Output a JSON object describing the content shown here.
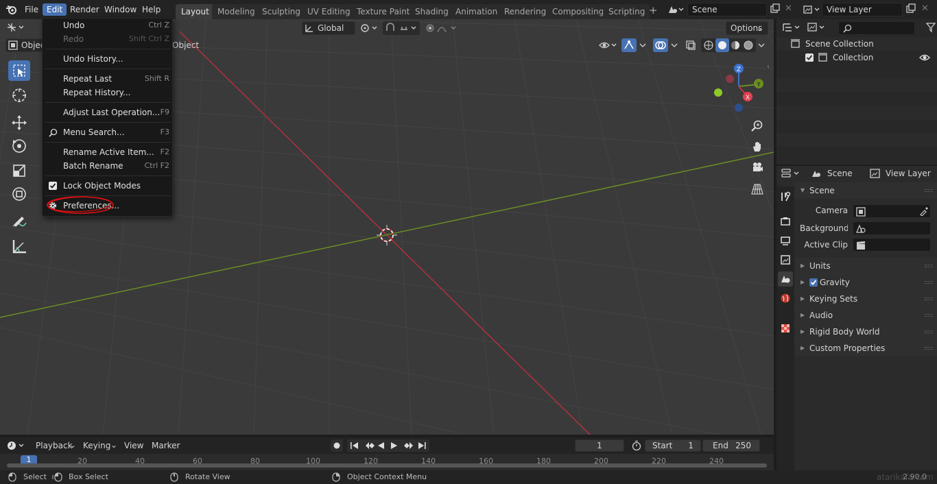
{
  "topbar": {
    "menus": [
      "File",
      "Edit",
      "Render",
      "Window",
      "Help"
    ],
    "active_menu": "Edit",
    "workspaces": [
      "Layout",
      "Modeling",
      "Sculpting",
      "UV Editing",
      "Texture Paint",
      "Shading",
      "Animation",
      "Rendering",
      "Compositing",
      "Scripting"
    ],
    "active_workspace": "Layout",
    "scene_name": "Scene",
    "view_layer_name": "View Layer"
  },
  "viewport_header": {
    "transform_orientation": "Global",
    "options_label": "Options",
    "mode_label": "Object",
    "object_menu": "Object"
  },
  "edit_menu": {
    "items": [
      {
        "label": "Undo",
        "shortcut": "Ctrl Z",
        "enabled": true
      },
      {
        "label": "Redo",
        "shortcut": "Shift Ctrl Z",
        "enabled": false
      },
      {
        "label": "Undo History...",
        "shortcut": "",
        "enabled": true
      },
      {
        "label": "Repeat Last",
        "shortcut": "Shift R",
        "enabled": true
      },
      {
        "label": "Repeat History...",
        "shortcut": "",
        "enabled": true
      },
      {
        "label": "Adjust Last Operation...",
        "shortcut": "F9",
        "enabled": true
      },
      {
        "label": "Menu Search...",
        "shortcut": "F3",
        "enabled": true
      },
      {
        "label": "Rename Active Item...",
        "shortcut": "F2",
        "enabled": true
      },
      {
        "label": "Batch Rename",
        "shortcut": "Ctrl F2",
        "enabled": true
      },
      {
        "label": "Lock Object Modes",
        "shortcut": "",
        "enabled": true,
        "checked": true
      },
      {
        "label": "Preferences...",
        "shortcut": "",
        "enabled": true,
        "highlighted": true
      }
    ]
  },
  "outliner": {
    "root": "Scene Collection",
    "children": [
      "Collection"
    ]
  },
  "properties": {
    "tabs": [
      "Scene",
      "View Layer"
    ],
    "panel_title": "Scene",
    "fields": [
      {
        "label": "Camera",
        "value": ""
      },
      {
        "label": "Background ...",
        "value": ""
      },
      {
        "label": "Active Clip",
        "value": ""
      }
    ],
    "subpanels": [
      "Units",
      "Gravity",
      "Keying Sets",
      "Audio",
      "Rigid Body World",
      "Custom Properties"
    ],
    "gravity_checked": true
  },
  "timeline": {
    "menus": [
      "Playback",
      "Keying",
      "View",
      "Marker"
    ],
    "current_frame": "1",
    "start_label": "Start",
    "start_value": "1",
    "end_label": "End",
    "end_value": "250",
    "ruler": [
      "1",
      "20",
      "40",
      "60",
      "80",
      "100",
      "120",
      "140",
      "160",
      "180",
      "200",
      "220",
      "240"
    ]
  },
  "statusbar": {
    "select": "Select",
    "box_select": "Box Select",
    "rotate_view": "Rotate View",
    "context_menu": "Object Context Menu",
    "version": "2.90.0",
    "watermark": "atarikafa.com"
  },
  "colors": {
    "accent": "#4772b3",
    "x_axis": "#b4303e",
    "y_axis": "#6a8f23",
    "annotation": "#e01010"
  }
}
